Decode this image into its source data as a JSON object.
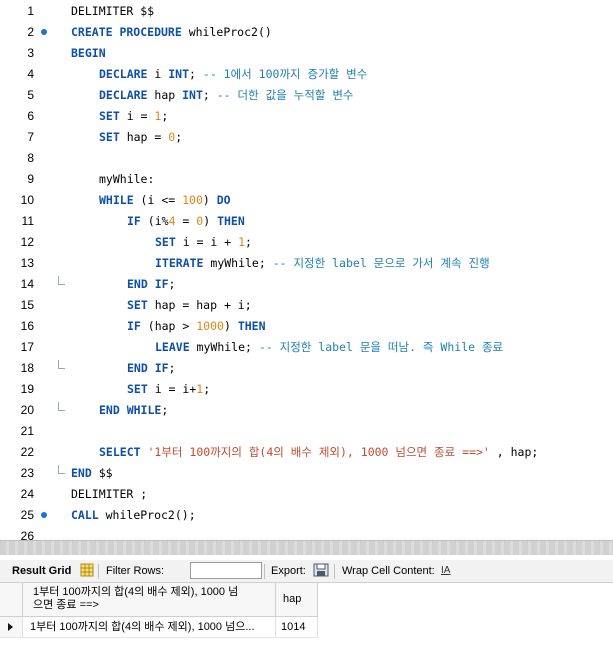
{
  "editor": {
    "lines": [
      {
        "n": "1",
        "dot": false,
        "fold": false,
        "indent": 0,
        "tokens": [
          {
            "t": "DELIMITER $$",
            "c": "op"
          }
        ]
      },
      {
        "n": "2",
        "dot": true,
        "fold": false,
        "indent": 0,
        "tokens": [
          {
            "t": "CREATE PROCEDURE ",
            "c": "kw"
          },
          {
            "t": "whileProc2()",
            "c": "op"
          }
        ]
      },
      {
        "n": "3",
        "dot": false,
        "fold": false,
        "indent": 0,
        "tokens": [
          {
            "t": "BEGIN",
            "c": "kw"
          }
        ]
      },
      {
        "n": "4",
        "dot": false,
        "fold": false,
        "indent": 1,
        "tokens": [
          {
            "t": "DECLARE ",
            "c": "kw"
          },
          {
            "t": "i ",
            "c": "op"
          },
          {
            "t": "INT",
            "c": "kw"
          },
          {
            "t": "; ",
            "c": "op"
          },
          {
            "t": "-- 1에서 100까지 증가할 변수",
            "c": "cm"
          }
        ]
      },
      {
        "n": "5",
        "dot": false,
        "fold": false,
        "indent": 1,
        "tokens": [
          {
            "t": "DECLARE ",
            "c": "kw"
          },
          {
            "t": "hap ",
            "c": "op"
          },
          {
            "t": "INT",
            "c": "kw"
          },
          {
            "t": "; ",
            "c": "op"
          },
          {
            "t": "-- 더한 값을 누적할 변수",
            "c": "cm"
          }
        ]
      },
      {
        "n": "6",
        "dot": false,
        "fold": false,
        "indent": 1,
        "tokens": [
          {
            "t": "SET ",
            "c": "kw"
          },
          {
            "t": "i = ",
            "c": "op"
          },
          {
            "t": "1",
            "c": "num"
          },
          {
            "t": ";",
            "c": "op"
          }
        ]
      },
      {
        "n": "7",
        "dot": false,
        "fold": false,
        "indent": 1,
        "tokens": [
          {
            "t": "SET ",
            "c": "kw"
          },
          {
            "t": "hap = ",
            "c": "op"
          },
          {
            "t": "0",
            "c": "num"
          },
          {
            "t": ";",
            "c": "op"
          }
        ]
      },
      {
        "n": "8",
        "dot": false,
        "fold": false,
        "indent": 0,
        "tokens": []
      },
      {
        "n": "9",
        "dot": false,
        "fold": false,
        "indent": 1,
        "tokens": [
          {
            "t": "myWhile:",
            "c": "op"
          }
        ]
      },
      {
        "n": "10",
        "dot": false,
        "fold": false,
        "indent": 1,
        "tokens": [
          {
            "t": "WHILE ",
            "c": "kw"
          },
          {
            "t": "(i <= ",
            "c": "op"
          },
          {
            "t": "100",
            "c": "num"
          },
          {
            "t": ") ",
            "c": "op"
          },
          {
            "t": "DO",
            "c": "kw"
          }
        ]
      },
      {
        "n": "11",
        "dot": false,
        "fold": false,
        "indent": 2,
        "tokens": [
          {
            "t": "IF ",
            "c": "kw"
          },
          {
            "t": "(i%",
            "c": "op"
          },
          {
            "t": "4",
            "c": "num"
          },
          {
            "t": " = ",
            "c": "op"
          },
          {
            "t": "0",
            "c": "num"
          },
          {
            "t": ") ",
            "c": "op"
          },
          {
            "t": "THEN",
            "c": "kw"
          }
        ]
      },
      {
        "n": "12",
        "dot": false,
        "fold": false,
        "indent": 3,
        "tokens": [
          {
            "t": "SET ",
            "c": "kw"
          },
          {
            "t": "i = i + ",
            "c": "op"
          },
          {
            "t": "1",
            "c": "num"
          },
          {
            "t": ";",
            "c": "op"
          }
        ]
      },
      {
        "n": "13",
        "dot": false,
        "fold": false,
        "indent": 3,
        "tokens": [
          {
            "t": "ITERATE ",
            "c": "kw"
          },
          {
            "t": "myWhile; ",
            "c": "op"
          },
          {
            "t": "-- 지정한 label 문으로 가서 계속 진행",
            "c": "cm"
          }
        ]
      },
      {
        "n": "14",
        "dot": false,
        "fold": true,
        "indent": 2,
        "tokens": [
          {
            "t": "END IF",
            "c": "kw"
          },
          {
            "t": ";",
            "c": "op"
          }
        ]
      },
      {
        "n": "15",
        "dot": false,
        "fold": false,
        "indent": 2,
        "tokens": [
          {
            "t": "SET ",
            "c": "kw"
          },
          {
            "t": "hap = hap + i;",
            "c": "op"
          }
        ]
      },
      {
        "n": "16",
        "dot": false,
        "fold": false,
        "indent": 2,
        "tokens": [
          {
            "t": "IF ",
            "c": "kw"
          },
          {
            "t": "(hap > ",
            "c": "op"
          },
          {
            "t": "1000",
            "c": "num"
          },
          {
            "t": ") ",
            "c": "op"
          },
          {
            "t": "THEN",
            "c": "kw"
          }
        ]
      },
      {
        "n": "17",
        "dot": false,
        "fold": false,
        "indent": 3,
        "tokens": [
          {
            "t": "LEAVE ",
            "c": "kw"
          },
          {
            "t": "myWhile; ",
            "c": "op"
          },
          {
            "t": "-- 지정한 label 문을 떠남. 즉 While 종료",
            "c": "cm"
          }
        ]
      },
      {
        "n": "18",
        "dot": false,
        "fold": true,
        "indent": 2,
        "tokens": [
          {
            "t": "END IF",
            "c": "kw"
          },
          {
            "t": ";",
            "c": "op"
          }
        ]
      },
      {
        "n": "19",
        "dot": false,
        "fold": false,
        "indent": 2,
        "tokens": [
          {
            "t": "SET ",
            "c": "kw"
          },
          {
            "t": "i = i+",
            "c": "op"
          },
          {
            "t": "1",
            "c": "num"
          },
          {
            "t": ";",
            "c": "op"
          }
        ]
      },
      {
        "n": "20",
        "dot": false,
        "fold": true,
        "indent": 1,
        "tokens": [
          {
            "t": "END WHILE",
            "c": "kw"
          },
          {
            "t": ";",
            "c": "op"
          }
        ]
      },
      {
        "n": "21",
        "dot": false,
        "fold": false,
        "indent": 0,
        "tokens": []
      },
      {
        "n": "22",
        "dot": false,
        "fold": false,
        "indent": 1,
        "tokens": [
          {
            "t": "SELECT ",
            "c": "kw"
          },
          {
            "t": "'1부터 100까지의 합(4의 배수 제외), 1000 넘으면 종료 ==>'",
            "c": "str"
          },
          {
            "t": " , hap;",
            "c": "op"
          }
        ]
      },
      {
        "n": "23",
        "dot": false,
        "fold": true,
        "indent": 0,
        "tokens": [
          {
            "t": "END ",
            "c": "kw"
          },
          {
            "t": "$$",
            "c": "op"
          }
        ]
      },
      {
        "n": "24",
        "dot": false,
        "fold": false,
        "indent": 0,
        "tokens": [
          {
            "t": "DELIMITER ;",
            "c": "op"
          }
        ]
      },
      {
        "n": "25",
        "dot": true,
        "fold": false,
        "indent": 0,
        "tokens": [
          {
            "t": "CALL ",
            "c": "kw"
          },
          {
            "t": "whileProc2();",
            "c": "op"
          }
        ]
      },
      {
        "n": "26",
        "dot": false,
        "fold": false,
        "indent": 0,
        "tokens": []
      }
    ]
  },
  "toolbar": {
    "result_grid": "Result Grid",
    "filter_rows": "Filter Rows:",
    "export": "Export:",
    "wrap_cell": "Wrap Cell Content:",
    "wrap_icon_glyph": "IA"
  },
  "grid": {
    "col1_header": "1부터 100까지의 합(4의 배수 제외), 1000 넘\n으면 종료 ==>",
    "col2_header": "hap",
    "row1_col1": "1부터 100까지의 합(4의 배수 제외), 1000 넘으...",
    "row1_col2": "1014"
  },
  "colors": {
    "keyword": "#0f4fa8",
    "number": "#e1841b",
    "string": "#c04a33",
    "comment": "#1e7fb0",
    "breakpoint_dot": "#1a74d3"
  }
}
